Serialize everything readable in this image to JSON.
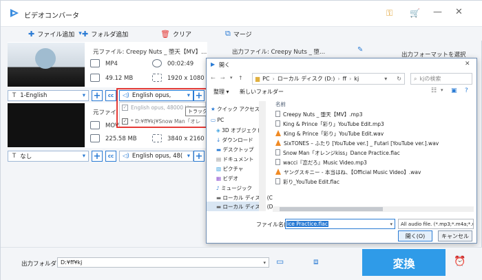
{
  "app": {
    "title": "ビデオコンバータ",
    "toolbar": {
      "add_file": "ファイル追加",
      "add_folder": "フォルダ追加",
      "clear": "クリア",
      "merge": "マージ"
    }
  },
  "files": [
    {
      "source": "元ファイル: Creepy Nuts _ 堕天【MV】...",
      "output": "出力ファイル: Creepy Nuts _ 堕...",
      "format": "MP4",
      "duration": "00:02:49",
      "size": "49.12 MB",
      "resolution": "1920 x 1080",
      "subtitle": "1-English",
      "audio": "English opus,"
    },
    {
      "source": "元ファイ",
      "format": "MOV",
      "size": "225.58 MB",
      "resolution": "3840 x 2160",
      "subtitle": "なし",
      "audio": "English opus, 48("
    }
  ],
  "output_format_label": "出力フォーマットを選択",
  "audio_dropdown": {
    "items": [
      "English opus, 48000 Hz,",
      "* D:¥ff¥kj¥Snow Man「オレ"
    ],
    "tooltip": "トラック"
  },
  "dialog": {
    "title": "開く",
    "path": [
      "PC",
      "ローカル ディスク (D:)",
      "ff",
      "kj"
    ],
    "search_placeholder": "kjの検索",
    "organize": "整理 ▾",
    "new_folder": "新しいフォルダー",
    "column_name": "名前",
    "nav": [
      "クイック アクセス",
      "PC",
      "3D オブジェクト",
      "ダウンロード",
      "デスクトップ",
      "ドキュメント",
      "ピクチャ",
      "ビデオ",
      "ミュージック",
      "ローカル ディスク (C",
      "ローカル ディスク (D"
    ],
    "files": [
      {
        "name": "Creepy Nuts _ 堕天【MV】.mp3",
        "icon": "doc"
      },
      {
        "name": "King & Prince「彩り」YouTube Edit.mp3",
        "icon": "doc"
      },
      {
        "name": "King & Prince「彩り」YouTube Edit.wav",
        "icon": "vlc-cone"
      },
      {
        "name": "SixTONES – ふたり [YouTube ver.] _ Futari [YouTube ver.].wav",
        "icon": "vlc-cone"
      },
      {
        "name": "Snow Man「オレンジkiss」Dance Practice.flac",
        "icon": "doc"
      },
      {
        "name": "wacci『恋だろ』Music Video.mp3",
        "icon": "doc"
      },
      {
        "name": "ヤングスキニー - 本当はね、【Official Music Video】.wav",
        "icon": "vlc-cone"
      },
      {
        "name": "彩り_YouTube Edit.flac",
        "icon": "doc"
      }
    ],
    "filename_label": "ファイル名(N):",
    "filename_value": "ice Practice.flac",
    "filter": "All audio file. (*.mp3;*.m4a;*.wi",
    "open": "開く(O)",
    "cancel": "キャンセル"
  },
  "bottom": {
    "output_folder_label": "出力フォルダ:",
    "output_folder_value": "D:¥ff¥kj",
    "convert": "変換"
  },
  "colors": {
    "accent": "#2a7bd4",
    "convert": "#2f9be8",
    "highlight": "#e53935"
  }
}
